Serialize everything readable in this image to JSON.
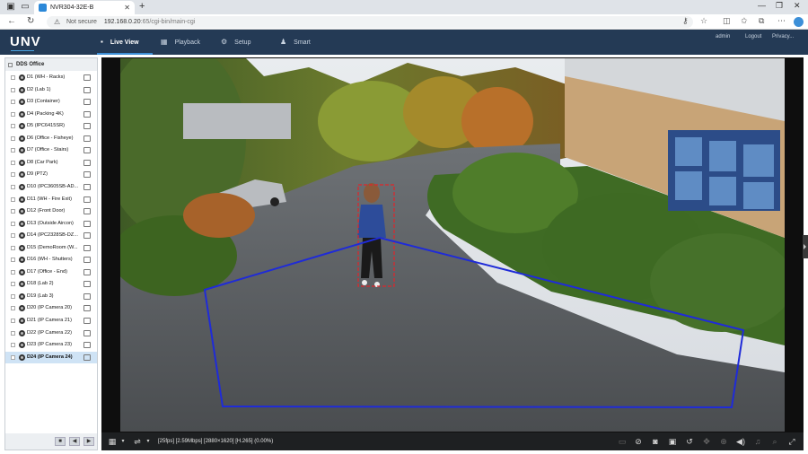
{
  "browser": {
    "tab_title": "NVR304-32E-B",
    "security_label": "Not secure",
    "url_host": "192.168.0.20",
    "url_path": ":65/cgi-bin/main-cgi"
  },
  "app": {
    "logo": "UNV",
    "nav": [
      {
        "label": "Live View",
        "icon": "monitor-icon"
      },
      {
        "label": "Playback",
        "icon": "film-icon"
      },
      {
        "label": "Setup",
        "icon": "gear-icon"
      },
      {
        "label": "Smart",
        "icon": "person-icon"
      }
    ],
    "user_links": [
      "admin",
      "Logout",
      "Privacy..."
    ]
  },
  "device_tree": {
    "root": "DDS Office",
    "cameras": [
      "D1 (WH - Racks)",
      "D2 (Lab 1)",
      "D3 (Container)",
      "D4 (Packing 4K)",
      "D5 (IPC6415SR)",
      "D6 (Office - Fisheye)",
      "D7 (Office - Stairs)",
      "D8 (Car Park)",
      "D9 (PTZ)",
      "D10 (IPC3605SB-AD...",
      "D11 (WH - Fire Exit)",
      "D12 (Front Door)",
      "D13 (Outside Aircon)",
      "D14 (IPC2328SB-DZ...",
      "D15 (DemoRoom (W...",
      "D16 (WH - Shutters)",
      "D17 (Office - End)",
      "D18 (Lab 2)",
      "D19 (Lab 3)",
      "D20 (IP Camera 20)",
      "D21 (IP Camera 21)",
      "D22 (IP Camera 22)",
      "D23 (IP Camera 23)",
      "D24 (IP Camera 24)"
    ],
    "selected": "D24 (IP Camera 24)"
  },
  "stream_status": "[25fps] [2.59Mbps] [2880×1620] [H.265] (0.00%)",
  "colors": {
    "header_bg": "#243a55",
    "accent": "#3d8fd6",
    "zone_line": "#1f2bd8",
    "target_box": "#e0252b"
  }
}
